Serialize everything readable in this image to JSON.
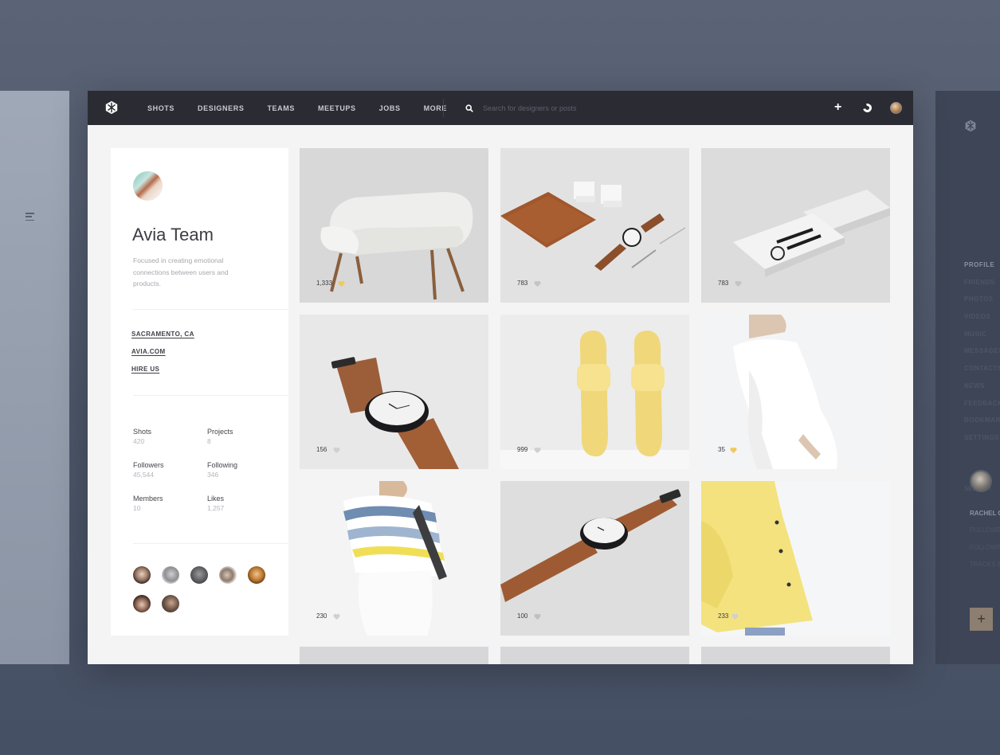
{
  "topbar": {
    "nav": [
      "SHOTS",
      "DESIGNERS",
      "TEAMS",
      "MEETUPS",
      "JOBS",
      "MORE"
    ],
    "search_placeholder": "Search for designers or posts"
  },
  "profile": {
    "name": "Avia Team",
    "description": "Focused in creating emotional connections between users and products.",
    "links": [
      "SACRAMENTO, CA",
      "AVIA.COM",
      "HIRE US"
    ],
    "stats": [
      {
        "label": "Shots",
        "value": "420"
      },
      {
        "label": "Projects",
        "value": "8"
      },
      {
        "label": "Followers",
        "value": "45,544"
      },
      {
        "label": "Following",
        "value": "346"
      },
      {
        "label": "Members",
        "value": "10"
      },
      {
        "label": "Likes",
        "value": "1,257"
      }
    ]
  },
  "shots": [
    {
      "subject": "armchair",
      "likes": "1,333",
      "liked": true
    },
    {
      "subject": "leather-set-watch",
      "likes": "783",
      "liked": false
    },
    {
      "subject": "watch-box",
      "likes": "783",
      "liked": false
    },
    {
      "subject": "watch-closeup",
      "likes": "156",
      "liked": false
    },
    {
      "subject": "yellow-sandals",
      "likes": "999",
      "liked": false
    },
    {
      "subject": "white-dress",
      "likes": "35",
      "liked": true
    },
    {
      "subject": "striped-top",
      "likes": "230",
      "liked": false
    },
    {
      "subject": "watch-angle",
      "likes": "100",
      "liked": false
    },
    {
      "subject": "yellow-coat",
      "likes": "233",
      "liked": false
    }
  ],
  "right_panel": {
    "nav": [
      "PROFILE",
      "FRIENDS",
      "PHOTOS",
      "VIDEOS",
      "MUSIC",
      "MESSAGES",
      "CONTACTS",
      "NEWS",
      "FEEDBACK",
      "BOOKMARKS",
      "SETTINGS"
    ],
    "search": "SEARCH",
    "user_name": "RACHEL C",
    "user_lines": [
      "FOLLOWERS",
      "FOLLOWING",
      "TRACKS 8"
    ]
  },
  "colors": {
    "topbar": "#2b2b34",
    "accent_heart": "#f2c85b",
    "background": "#4c5669"
  }
}
